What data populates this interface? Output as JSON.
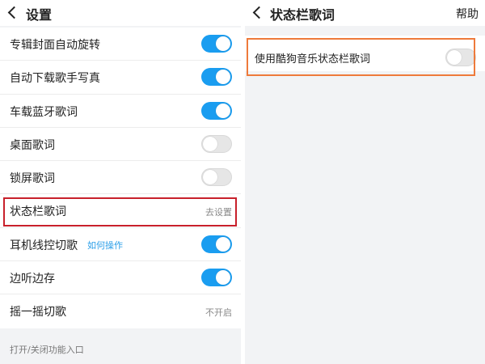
{
  "left": {
    "title": "设置",
    "rows": [
      {
        "label": "专辑封面自动旋转",
        "control": "toggle",
        "on": true
      },
      {
        "label": "自动下载歌手写真",
        "control": "toggle",
        "on": true
      },
      {
        "label": "车载蓝牙歌词",
        "control": "toggle",
        "on": true
      },
      {
        "label": "桌面歌词",
        "control": "toggle",
        "on": false
      },
      {
        "label": "锁屏歌词",
        "control": "toggle",
        "on": false
      },
      {
        "label": "状态栏歌词",
        "control": "value",
        "value": "去设置"
      },
      {
        "label": "耳机线控切歌",
        "link": "如何操作",
        "control": "toggle",
        "on": true
      },
      {
        "label": "边听边存",
        "control": "toggle",
        "on": true
      },
      {
        "label": "摇一摇切歌",
        "control": "value",
        "value": "不开启"
      }
    ],
    "footer": "打开/关闭功能入口"
  },
  "right": {
    "title": "状态栏歌词",
    "help": "帮助",
    "option_label": "使用酷狗音乐状态栏歌词",
    "option_on": false
  },
  "colors": {
    "toggle_on": "#1a9df0",
    "toggle_off": "#e6e6e6",
    "highlight_left": "#c8202b",
    "highlight_right": "#ee7a3b",
    "link": "#2a9ee8"
  }
}
